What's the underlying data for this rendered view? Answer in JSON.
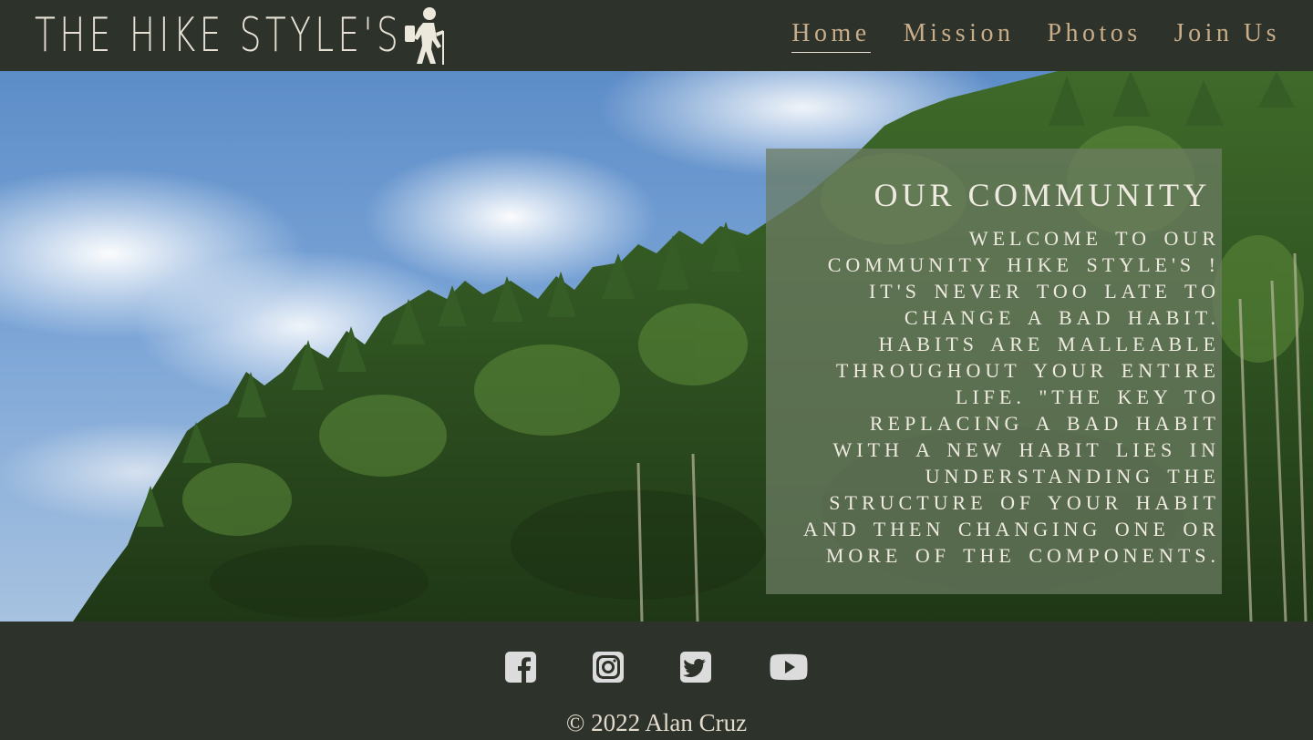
{
  "header": {
    "brand": "THE HIKE STYLE'S",
    "logo_icon": "hiker-icon",
    "nav": [
      {
        "label": "Home",
        "active": true
      },
      {
        "label": "Mission",
        "active": false
      },
      {
        "label": "Photos",
        "active": false
      },
      {
        "label": "Join Us",
        "active": false
      }
    ]
  },
  "hero": {
    "background": "sky with clouds and tall eucalyptus trees",
    "panel": {
      "title": "OUR COMMUNITY",
      "body": "Welcome to our community Hike Style's ! It's never too late to change a bad habit. Habits are malleable throughout your entire life. \"The key to replacing a bad habit with a new habit lies in understanding the structure of your habit and then changing one or more of the components."
    }
  },
  "footer": {
    "social": [
      {
        "icon": "facebook-icon"
      },
      {
        "icon": "instagram-icon"
      },
      {
        "icon": "twitter-icon"
      },
      {
        "icon": "youtube-icon"
      }
    ],
    "copyright": "© 2022 Alan Cruz"
  },
  "colors": {
    "header_bg": "#2d322b",
    "nav_text": "#c8ad88",
    "brand_text": "#e6e1d4",
    "panel_bg": "#6c7c62"
  }
}
